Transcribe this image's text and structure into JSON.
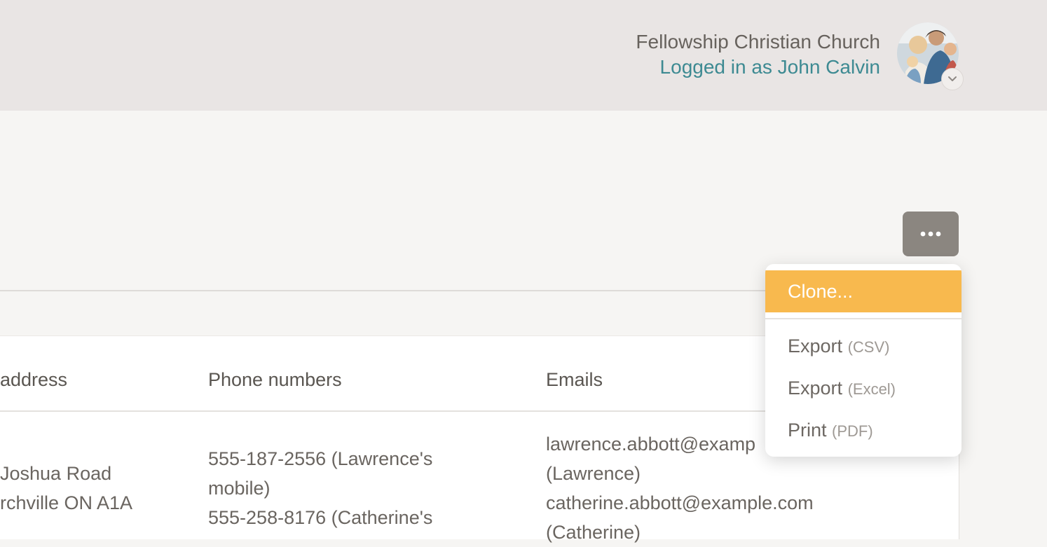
{
  "header": {
    "org_name": "Fellowship Christian Church",
    "login_text": "Logged in as John Calvin"
  },
  "table": {
    "headers": [
      "address",
      "Phone numbers",
      "Emails"
    ],
    "row": {
      "address": [
        "Joshua Road",
        "rchville ON A1A"
      ],
      "phones": [
        "555-187-2556 (Lawrence's",
        "mobile)",
        "555-258-8176 (Catherine's"
      ],
      "emails": [
        "lawrence.abbott@examp",
        "(Lawrence)",
        "catherine.abbott@example.com",
        "(Catherine)"
      ]
    }
  },
  "menu": {
    "items": [
      {
        "label": "Clone...",
        "sub": ""
      },
      {
        "label": "Export",
        "sub": "(CSV)"
      },
      {
        "label": "Export",
        "sub": "(Excel)"
      },
      {
        "label": "Print",
        "sub": "(PDF)"
      }
    ]
  },
  "colors": {
    "accent": "#f8b94e",
    "link": "#3d8a92",
    "header_bg": "#e9e5e4",
    "button_bg": "#8b8680"
  }
}
